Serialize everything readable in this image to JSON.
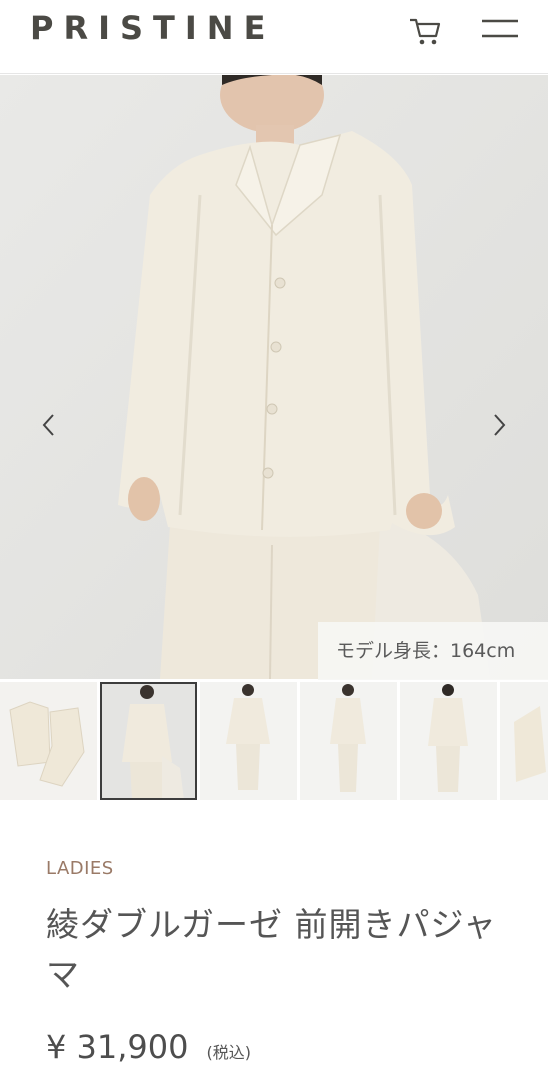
{
  "header": {
    "logo": "PRISTINE",
    "cart_icon": "cart-icon",
    "menu_icon": "hamburger-menu-icon"
  },
  "hero": {
    "model_height_label": "モデル身長：164cm",
    "prev_icon": "chevron-left-icon",
    "next_icon": "chevron-right-icon"
  },
  "thumbnails": {
    "count": 6,
    "selected_index": 1
  },
  "product": {
    "category": "LADIES",
    "title": "綾ダブルガーゼ 前開きパジャマ",
    "price": "¥ 31,900",
    "tax_label": "(税込)"
  },
  "colors": {
    "brand_text": "#4b4a45",
    "category": "#9a7a67",
    "garment": "#f1ece0",
    "background": "#e7e7e5"
  }
}
